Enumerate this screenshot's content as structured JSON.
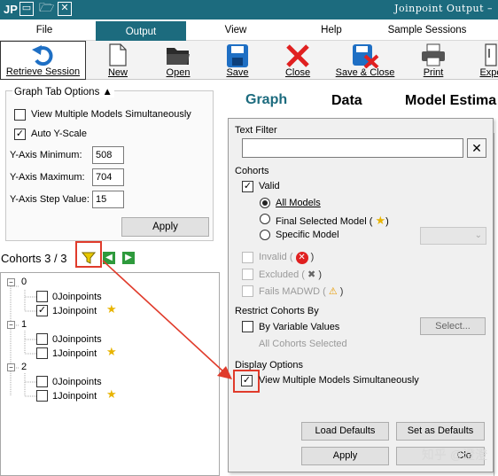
{
  "app": {
    "badge": "JP",
    "window_title": "Joinpoint Output –"
  },
  "menu": {
    "items": [
      "File",
      "Output",
      "View",
      "Help",
      "Sample Sessions"
    ],
    "active": "Output"
  },
  "toolbar": {
    "retrieve": "Retrieve Session",
    "new": "New",
    "open": "Open",
    "save": "Save",
    "close": "Close",
    "save_close": "Save & Close",
    "print": "Print",
    "export": "Expo"
  },
  "graph_tab_options": {
    "title": "Graph Tab Options",
    "view_multiple_label": "View Multiple Models Simultaneously",
    "view_multiple_checked": false,
    "auto_y_label": "Auto Y-Scale",
    "auto_y_checked": true,
    "ymin_label": "Y-Axis Minimum:",
    "ymin_value": "508",
    "ymax_label": "Y-Axis Maximum:",
    "ymax_value": "704",
    "ystep_label": "Y-Axis Step Value:",
    "ystep_value": "15",
    "apply": "Apply"
  },
  "cohorts_bar": {
    "label": "Cohorts 3 / 3"
  },
  "tree": [
    {
      "node": "0",
      "rows": [
        {
          "label": "0Joinpoints",
          "checked": false,
          "star": false
        },
        {
          "label": "1Joinpoint",
          "checked": true,
          "star": true
        }
      ]
    },
    {
      "node": "1",
      "rows": [
        {
          "label": "0Joinpoints",
          "checked": false,
          "star": false
        },
        {
          "label": "1Joinpoint",
          "checked": false,
          "star": true
        }
      ]
    },
    {
      "node": "2",
      "rows": [
        {
          "label": "0Joinpoints",
          "checked": false,
          "star": false
        },
        {
          "label": "1Joinpoint",
          "checked": false,
          "star": true
        }
      ]
    }
  ],
  "tabs": {
    "graph": "Graph",
    "data": "Data",
    "model": "Model Estima"
  },
  "popup": {
    "text_filter": "Text Filter",
    "text_filter_value": "",
    "cohorts": "Cohorts",
    "valid": "Valid",
    "all_models": "All Models",
    "final_selected": "Final Selected Model (",
    "specific_model": "Specific Model",
    "invalid": "Invalid (",
    "excluded": "Excluded (",
    "fails_madwd": "Fails MADWD (",
    "close_paren": ")",
    "restrict": "Restrict Cohorts By",
    "by_variable": "By Variable Values",
    "select_btn": "Select...",
    "all_selected": "All Cohorts Selected",
    "display_options": "Display Options",
    "view_multiple": "View Multiple Models Simultaneously",
    "load_defaults": "Load Defaults",
    "set_defaults": "Set as Defaults",
    "apply": "Apply",
    "close": "Clo"
  },
  "watermark": "知乎 @澄澄",
  "colors": {
    "teal": "#1c6b7e",
    "highlight_red": "#e03b2b",
    "graph_tab": "#1c6b7e"
  }
}
